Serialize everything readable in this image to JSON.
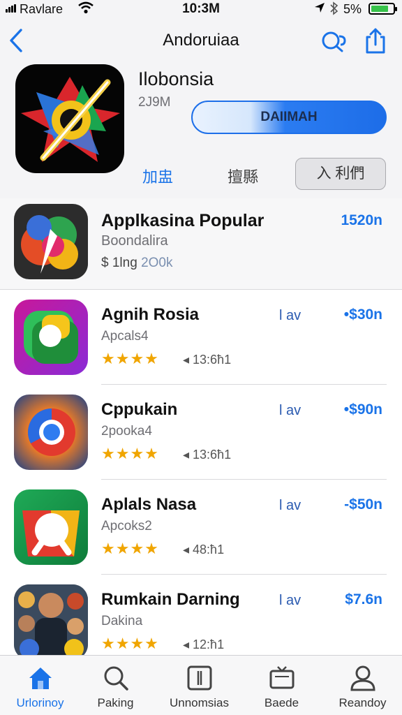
{
  "status_bar": {
    "carrier": "Ravlare",
    "time": "10:3M",
    "battery_percent": "5%",
    "battery_color": "#37c24a"
  },
  "nav": {
    "title": "Andoruiaa",
    "back_icon": "chevron-left-icon",
    "search_icon": "search-icon",
    "share_icon": "share-icon"
  },
  "featured": {
    "name": "Ilobonsia",
    "size": "2J9M",
    "get_button": "DAIIMAH",
    "link_primary": "加盅",
    "link_secondary": "擅縣",
    "segment_button": "入 利們"
  },
  "popular": {
    "title": "Applkasina Popular",
    "subtitle": "Boondalira",
    "meta_prefix": "$ 1lng",
    "meta_value": "2O0k",
    "price": "1520n"
  },
  "apps": [
    {
      "name": "Agnih Rosia",
      "subtitle": "Apcals4",
      "stars": "★★★★",
      "count": "◂ 13:6ħ1",
      "downloads": "l av",
      "price": "•$30n"
    },
    {
      "name": "Cppukain",
      "subtitle": "2pooka4",
      "stars": "★★★★",
      "count": "◂ 13:6ħ1",
      "downloads": "l av",
      "price": "•$90n"
    },
    {
      "name": "Aplals Nasa",
      "subtitle": "Apcoks2",
      "stars": "★★★★",
      "count": "◂ 48:ħ1",
      "downloads": "l av",
      "price": "-$50n"
    },
    {
      "name": "Rumkain Darning",
      "subtitle": "Dakina",
      "stars": "★★★★",
      "count": "◂ 12:ħ1",
      "downloads": "l av",
      "price": "$7.6n"
    }
  ],
  "tabs": [
    {
      "label": "Urlorinoy",
      "icon": "home-icon",
      "active": true
    },
    {
      "label": "Paking",
      "icon": "search-icon",
      "active": false
    },
    {
      "label": "Unnomsias",
      "icon": "document-icon",
      "active": false
    },
    {
      "label": "Baede",
      "icon": "tv-icon",
      "active": false
    },
    {
      "label": "Reandoy",
      "icon": "person-icon",
      "active": false
    }
  ],
  "accent_color": "#1a73e8"
}
